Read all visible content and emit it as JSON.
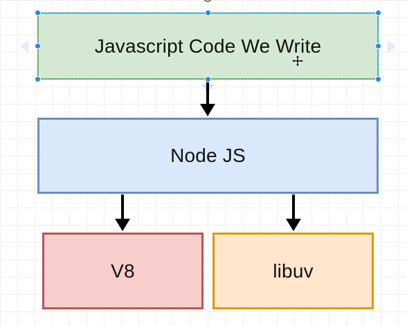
{
  "diagram": {
    "nodes": [
      {
        "id": "js-code",
        "label": "Javascript Code We Write"
      },
      {
        "id": "nodejs",
        "label": "Node JS"
      },
      {
        "id": "v8",
        "label": "V8"
      },
      {
        "id": "libuv",
        "label": "libuv"
      }
    ],
    "edges": [
      {
        "from": "js-code",
        "to": "nodejs"
      },
      {
        "from": "nodejs",
        "to": "v8"
      },
      {
        "from": "nodejs",
        "to": "libuv"
      }
    ],
    "selected_node": "js-code"
  },
  "colors": {
    "js_code_fill": "#d5e8d4",
    "js_code_stroke": "#82b366",
    "nodejs_fill": "#dae8fc",
    "nodejs_stroke": "#6c8ebf",
    "v8_fill": "#f8cecc",
    "v8_stroke": "#b85450",
    "libuv_fill": "#ffe6cc",
    "libuv_stroke": "#d79b00",
    "selection_handle": "#1d8bf1",
    "arrow": "#000000"
  },
  "icons": {
    "cursor": "move-cursor-icon",
    "hover_arrows": "connect-arrow-icon"
  }
}
